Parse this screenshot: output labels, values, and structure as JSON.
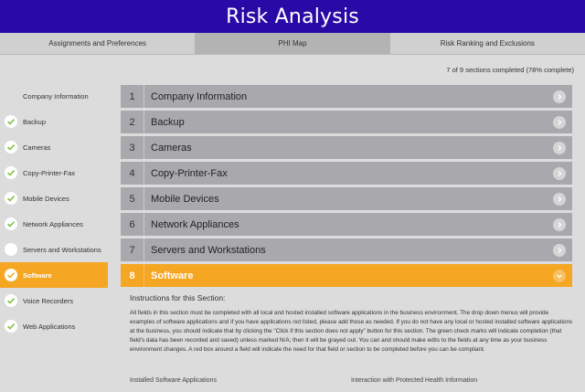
{
  "app": {
    "title": "Risk Analysis"
  },
  "tabs": [
    {
      "label": "Assignments and Preferences",
      "active": false
    },
    {
      "label": "PHI Map",
      "active": true
    },
    {
      "label": "Risk Ranking and Exclusions",
      "active": false
    }
  ],
  "progress": {
    "text": "7 of 9 sections completed (78% complete)",
    "completed": 7,
    "total": 9,
    "percent": 78
  },
  "sidebar": {
    "items": [
      {
        "label": "Company Information",
        "status": "none"
      },
      {
        "label": "Backup",
        "status": "complete"
      },
      {
        "label": "Cameras",
        "status": "complete"
      },
      {
        "label": "Copy-Printer-Fax",
        "status": "complete"
      },
      {
        "label": "Mobile Devices",
        "status": "complete"
      },
      {
        "label": "Network Appliances",
        "status": "complete"
      },
      {
        "label": "Servers and Workstations",
        "status": "incomplete"
      },
      {
        "label": "Software",
        "status": "active"
      },
      {
        "label": "Voice Recorders",
        "status": "complete"
      },
      {
        "label": "Web Applications",
        "status": "complete"
      }
    ]
  },
  "sections": [
    {
      "num": "1",
      "label": "Company Information"
    },
    {
      "num": "2",
      "label": "Backup"
    },
    {
      "num": "3",
      "label": "Cameras"
    },
    {
      "num": "4",
      "label": "Copy-Printer-Fax"
    },
    {
      "num": "5",
      "label": "Mobile Devices"
    },
    {
      "num": "6",
      "label": "Network Appliances"
    },
    {
      "num": "7",
      "label": "Servers and Workstations"
    },
    {
      "num": "8",
      "label": "Software",
      "active": true
    }
  ],
  "instructions": {
    "heading": "Instructions for this Section:",
    "body": "All fields in this section must be completed with all local and hosted installed software applications in the business environment. The drop down menus will provide examples of software applications and if you have applications not listed, please add those as needed. If you do not have any local or hosted installed software applications at the business, you should indicate that by clicking the \"Click if this section does not apply\" button for this section. The green check marks will indicate completion (that field's data has been recorded and saved) unless marked N/A; then it will be grayed out. You can and should make edits to the fields at any time as your business environment changes. A red box around a field will indicate the need for that field or section to be completed before you can be compliant."
  },
  "columns": {
    "left": "Installed Software Applications",
    "right": "Interaction with Protected Health Information"
  },
  "colors": {
    "header": "#2a0aa6",
    "accent": "#f5a623",
    "check": "#7cc242"
  }
}
